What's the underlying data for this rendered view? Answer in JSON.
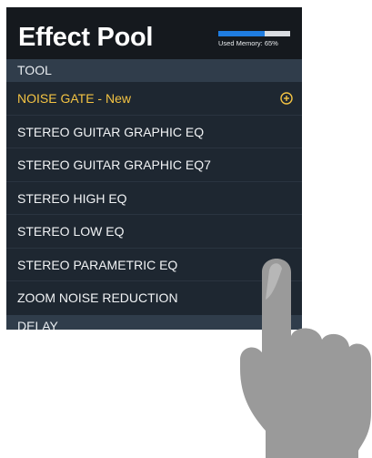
{
  "title": "Effect Pool",
  "memory": {
    "label": "Used Memory: 65%",
    "percent": 65
  },
  "sections": [
    {
      "name": "TOOL",
      "items": [
        {
          "label": "NOISE GATE - New",
          "is_new": true
        },
        {
          "label": "STEREO GUITAR GRAPHIC EQ"
        },
        {
          "label": "STEREO GUITAR GRAPHIC EQ7"
        },
        {
          "label": "STEREO HIGH EQ"
        },
        {
          "label": "STEREO LOW EQ"
        },
        {
          "label": "STEREO PARAMETRIC EQ"
        },
        {
          "label": "ZOOM NOISE REDUCTION"
        }
      ]
    },
    {
      "name": "DELAY",
      "items": []
    }
  ],
  "icons": {
    "add": "add-circle-icon",
    "hand": "pointing-hand-icon"
  },
  "colors": {
    "header_bg": "#15191e",
    "list_bg": "#1e2731",
    "section_bg": "#303d4b",
    "new_item": "#f3c343",
    "memory_bar": "#1f7de1",
    "hand": "#9a9a9a"
  }
}
